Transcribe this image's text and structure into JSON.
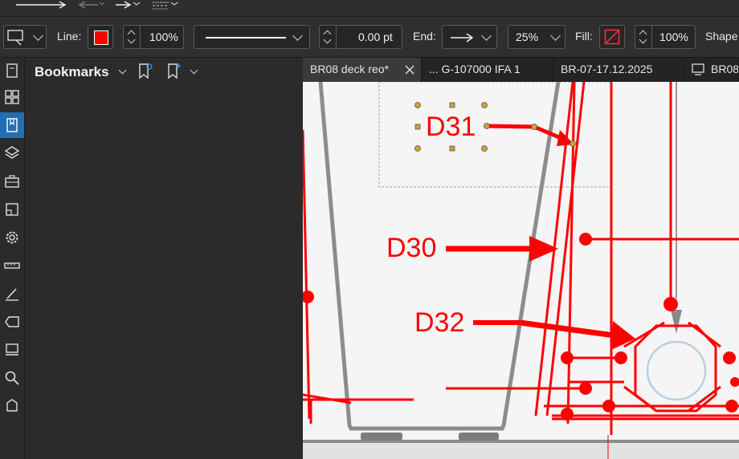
{
  "toolbar": {
    "line_label": "Line:",
    "line_color": "#ff0000",
    "line_opacity": "100%",
    "line_width": "0.00 pt",
    "end_label": "End:",
    "scale": "25%",
    "fill_label": "Fill:",
    "fill_opacity": "100%",
    "shape_label": "Shape"
  },
  "panel": {
    "title": "Bookmarks"
  },
  "tabs": [
    {
      "label": "BR08 deck reo*",
      "active": true
    },
    {
      "label": "... G-107000 IFA 1",
      "active": false
    },
    {
      "label": "BR-07-17.12.2025",
      "active": false
    },
    {
      "label": "BR08",
      "active": false
    }
  ],
  "drawing": {
    "labels": [
      "D31",
      "D30",
      "D32"
    ],
    "markup_color": "#ff0000"
  },
  "rail_icons": [
    "document-icon",
    "thumbnails-icon",
    "bookmarks-icon",
    "layers-icon",
    "toolbox-icon",
    "crop-icon",
    "settings-icon",
    "measure-icon",
    "signature-icon",
    "tag-icon",
    "stamp-icon",
    "search-icon",
    "shape-icon"
  ]
}
